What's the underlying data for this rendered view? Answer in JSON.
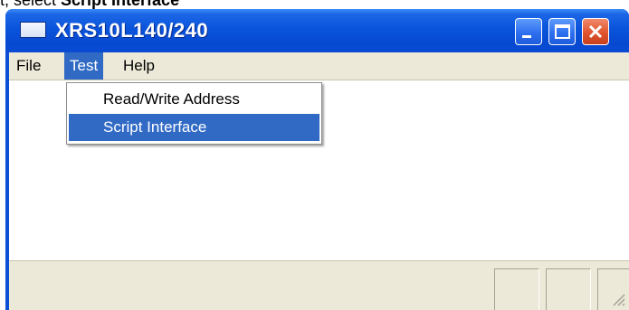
{
  "instruction": {
    "prefix": "t, select ",
    "target": "Script Interface"
  },
  "window": {
    "title": "XRS10L140/240",
    "buttons": {
      "minimize": "minimize",
      "maximize": "maximize",
      "close": "close"
    }
  },
  "menubar": {
    "items": [
      {
        "label": "File"
      },
      {
        "label": "Test",
        "state": "open"
      },
      {
        "label": "Help"
      }
    ]
  },
  "dropdown": {
    "items": [
      {
        "label": "Read/Write Address"
      },
      {
        "label": "Script Interface",
        "state": "highlighted"
      }
    ]
  },
  "colors": {
    "titlebar": "#0a54dc",
    "menu_highlight": "#316ac5",
    "chrome": "#ece9d8",
    "close_button": "#e0532f"
  },
  "icons": [
    "app-window-icon",
    "minimize-icon",
    "maximize-icon",
    "close-icon",
    "resize-grip-icon"
  ]
}
